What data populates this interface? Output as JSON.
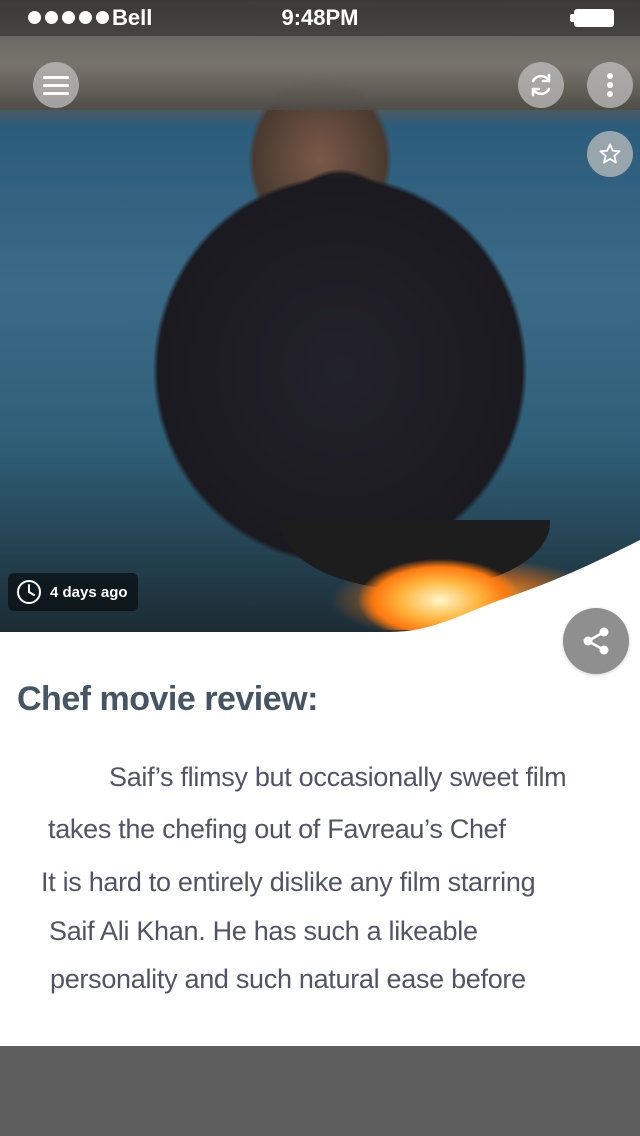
{
  "status_bar": {
    "carrier": "Bell",
    "time": "9:48PM"
  },
  "hero": {
    "icons": {
      "menu": "hamburger-icon",
      "refresh": "refresh-icon",
      "more": "more-vertical-icon",
      "favorite": "star-icon",
      "share": "share-icon",
      "clock": "clock-icon"
    },
    "time_ago": "4 days ago"
  },
  "article": {
    "title": "Chef movie review:",
    "lines": [
      "Saif’s flimsy but occasionally sweet film",
      "takes the chefing out of Favreau’s Chef",
      "It is hard to entirely dislike any film starring",
      "Saif Ali Khan. He has such a likeable",
      "personality and such natural ease before"
    ]
  },
  "colors": {
    "title": "#455563",
    "body_text": "#505466",
    "footer": "#5e5e5e",
    "share_button": "#8f8f8f"
  }
}
